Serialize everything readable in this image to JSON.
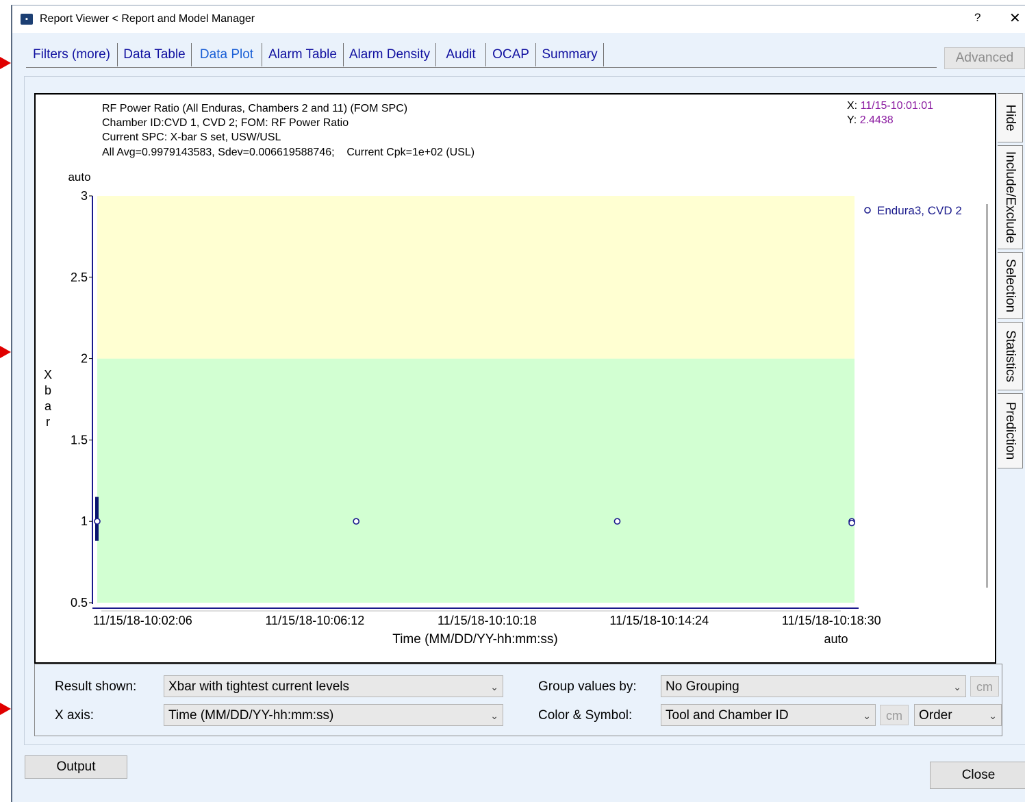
{
  "window": {
    "title": "Report Viewer < Report and Model Manager",
    "help_label": "?",
    "close_label": "✕"
  },
  "tabs": [
    {
      "label": "Filters (more)",
      "active": false
    },
    {
      "label": "Data Table",
      "active": false
    },
    {
      "label": "Data Plot",
      "active": true
    },
    {
      "label": "Alarm Table",
      "active": false
    },
    {
      "label": "Alarm Density",
      "active": false
    },
    {
      "label": "Audit",
      "active": false
    },
    {
      "label": "OCAP",
      "active": false
    },
    {
      "label": "Summary",
      "active": false
    }
  ],
  "advanced_button": "Advanced",
  "plot_info": {
    "line1": "RF Power Ratio (All Enduras, Chambers 2 and 11) (FOM SPC)",
    "line2": "Chamber ID:CVD 1, CVD 2; FOM: RF Power Ratio",
    "line3": "Current SPC: X-bar S set, USW/USL",
    "line4": "All Avg=0.9979143583, Sdev=0.006619588746;    Current Cpk=1e+02 (USL)"
  },
  "cursor": {
    "x_prefix": "X: ",
    "x_value": "11/15-10:01:01",
    "y_prefix": "Y: ",
    "y_value": "2.4438"
  },
  "side_tabs": [
    "Hide",
    "Include/Exclude",
    "Selection",
    "Statistics",
    "Prediction"
  ],
  "chart_data": {
    "type": "scatter",
    "ylabel": "Xbar",
    "xlabel": "Time (MM/DD/YY-hh:mm:ss)",
    "y_auto_label": "auto",
    "x_auto_label": "auto",
    "ylim": [
      0.5,
      3
    ],
    "yticks": [
      0.5,
      1,
      1.5,
      2,
      2.5,
      3
    ],
    "ytick_labels": [
      "0.5",
      "1",
      "1.5",
      "2",
      "2.5",
      "3"
    ],
    "xticks": [
      "11/15/18-10:02:06",
      "11/15/18-10:06:12",
      "11/15/18-10:10:18",
      "11/15/18-10:14:24",
      "11/15/18-10:18:30"
    ],
    "xlim": [
      "11/15/18-10:01:01",
      "11/15/18-10:19:03"
    ],
    "zones": [
      {
        "from": 0.5,
        "to": 2.0,
        "color": "#d2ffd2"
      },
      {
        "from": 2.0,
        "to": 3.0,
        "color": "#ffffd2"
      }
    ],
    "series": [
      {
        "name": "Endura3, CVD 2",
        "color": "#1a1a8c",
        "x": [
          "11/15/18-10:01:01",
          "11/15/18-10:07:11",
          "11/15/18-10:13:24",
          "11/15/18-10:19:31",
          "11/15/18-10:25:26"
        ],
        "y": [
          1.0,
          1.0,
          1.0,
          1.0,
          0.99
        ]
      }
    ],
    "legend": "top-right"
  },
  "controls": {
    "result_label": "Result shown:",
    "result_value": "Xbar with tightest current levels",
    "xaxis_label": "X axis:",
    "xaxis_value": "Time (MM/DD/YY-hh:mm:ss)",
    "group_label": "Group values by:",
    "group_value": "No Grouping",
    "color_label": "Color & Symbol:",
    "color_value": "Tool and Chamber ID",
    "order_value": "Order",
    "cm_label": "cm"
  },
  "output_button": "Output",
  "close_button": "Close"
}
